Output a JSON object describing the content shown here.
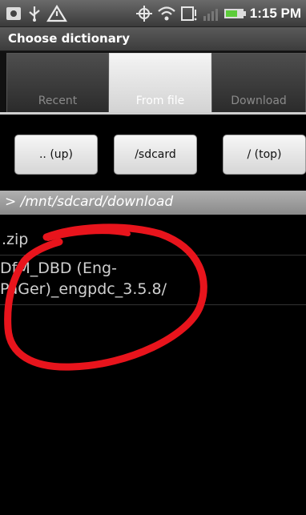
{
  "status_bar": {
    "time": "1:15 PM",
    "icons": [
      "screenshot-icon",
      "usb-icon",
      "warning-icon",
      "gps-icon",
      "wifi-icon",
      "notification-icon",
      "signal-icon",
      "battery-icon"
    ]
  },
  "dialog": {
    "title": "Choose dictionary"
  },
  "tabs": [
    {
      "label": "Recent",
      "selected": false
    },
    {
      "label": "From file",
      "selected": true
    },
    {
      "label": "Download",
      "selected": false
    }
  ],
  "buttons": {
    "up_label": ".. (up)",
    "sdcard_label": "/sdcard",
    "top_label": "/ (top)"
  },
  "path": "> /mnt/sdcard/download",
  "files": [
    {
      "label": ".zip"
    },
    {
      "label": "DfM_DBD (Eng-\nPaGer)_engpdc_3.5.8/"
    }
  ],
  "colors": {
    "annotation": "#e8141c",
    "selected_tab": "#e6e6e6",
    "path_bar": "#9e9e9e"
  }
}
